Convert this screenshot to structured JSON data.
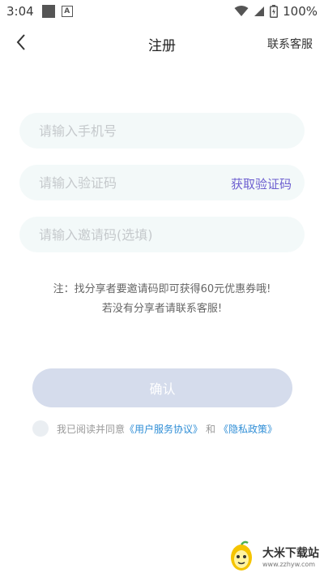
{
  "status_bar": {
    "time": "3:04",
    "battery": "100%"
  },
  "nav": {
    "title": "注册",
    "service_label": "联系客服"
  },
  "form": {
    "phone_placeholder": "请输入手机号",
    "code_placeholder": "请输入验证码",
    "get_code_label": "获取验证码",
    "invite_placeholder": "请输入邀请码(选填)"
  },
  "note": {
    "line1": "注：找分享者要邀请码即可获得60元优惠券哦!",
    "line2": "若没有分享者请联系客服!"
  },
  "confirm_label": "确认",
  "agreement": {
    "text": "我已阅读并同意",
    "user_agreement": "《用户服务协议》",
    "and": "和",
    "privacy_policy": "《隐私政策》"
  },
  "watermark": {
    "title": "大米下载站",
    "url": "www.zzhyw.com"
  },
  "colors": {
    "accent": "#6d5fd0",
    "link": "#2f8ed6",
    "input_bg": "#f3f9f9",
    "button_disabled": "#d5dcec"
  }
}
